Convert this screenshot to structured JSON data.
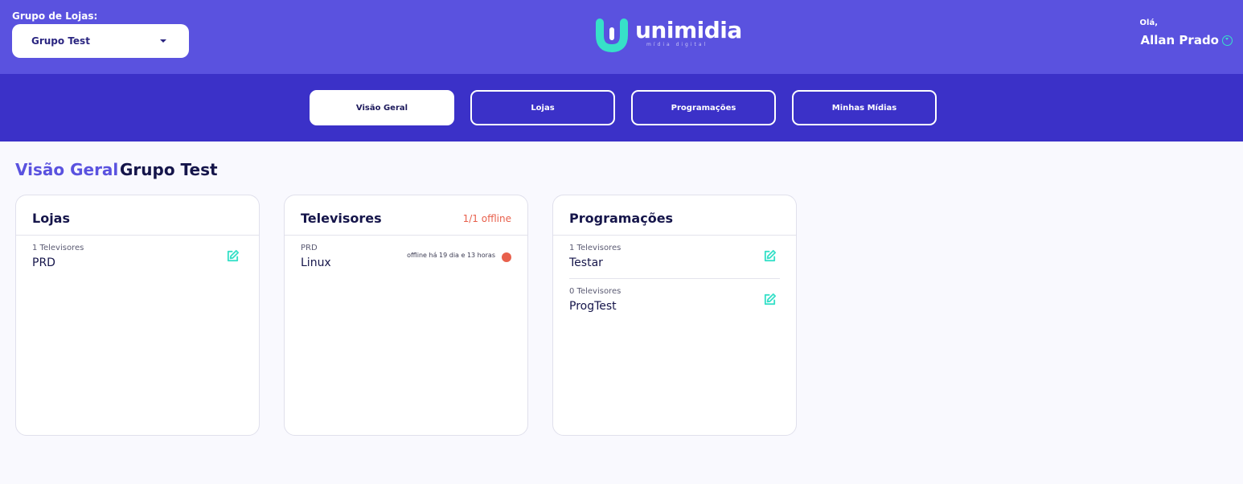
{
  "header": {
    "store_group_label": "Grupo de Lojas:",
    "store_group_value": "Grupo Test",
    "logo_name": "unimidia",
    "logo_tagline": "mídia digital",
    "greeting": "Olá,",
    "user_name": "Allan Prado"
  },
  "nav": {
    "tabs": [
      {
        "label": "Visão Geral",
        "active": true
      },
      {
        "label": "Lojas",
        "active": false
      },
      {
        "label": "Programações",
        "active": false
      },
      {
        "label": "Minhas Mídias",
        "active": false
      }
    ]
  },
  "page": {
    "title": "Visão Geral",
    "subtitle": "Grupo Test"
  },
  "cards": {
    "stores": {
      "title": "Lojas",
      "items": [
        {
          "sub": "1 Televisores",
          "name": "PRD"
        }
      ]
    },
    "tvs": {
      "title": "Televisores",
      "status": "1/1 offline",
      "items": [
        {
          "sub": "PRD",
          "name": "Linux",
          "status": "offline há 19 dia e 13 horas"
        }
      ]
    },
    "schedules": {
      "title": "Programações",
      "items": [
        {
          "sub": "1 Televisores",
          "name": "Testar"
        },
        {
          "sub": "0 Televisores",
          "name": "ProgTest"
        }
      ]
    }
  },
  "icons": {
    "edit": "edit-icon",
    "user_menu": "chevron-down-circle-icon",
    "dropdown": "caret-down-icon",
    "status_offline": "status-dot-icon"
  },
  "colors": {
    "header_bg": "#5a52df",
    "nav_bg": "#3b31c8",
    "accent": "#37e0c8",
    "offline": "#e8604c",
    "title_accent": "#5a52df",
    "text_dark": "#15154a"
  }
}
